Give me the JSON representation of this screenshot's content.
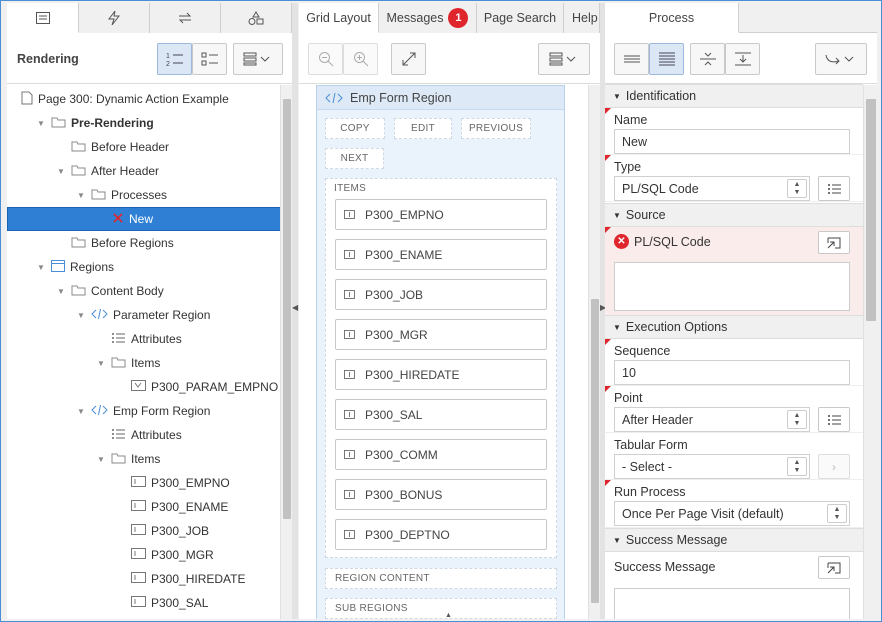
{
  "left_panel": {
    "tabs": [
      {
        "icon": "tree-list-icon",
        "active": true
      },
      {
        "icon": "lightning-icon",
        "active": false
      },
      {
        "icon": "arrows-exchange-icon",
        "active": false
      },
      {
        "icon": "shapes-icon",
        "active": false
      }
    ],
    "toolbar_title": "Rendering",
    "tree": [
      {
        "label": "Page 300: Dynamic Action Example",
        "icon": "page-icon",
        "level": 0,
        "toggle": ""
      },
      {
        "label": "Pre-Rendering",
        "icon": "folder-icon",
        "level": 1,
        "toggle": "open",
        "bold": true
      },
      {
        "label": "Before Header",
        "icon": "folder-icon",
        "level": 2,
        "toggle": ""
      },
      {
        "label": "After Header",
        "icon": "folder-icon",
        "level": 2,
        "toggle": "open"
      },
      {
        "label": "Processes",
        "icon": "folder-icon",
        "level": 3,
        "toggle": "open"
      },
      {
        "label": "New",
        "icon": "error-x-icon",
        "level": 4,
        "toggle": "",
        "selected": true
      },
      {
        "label": "Before Regions",
        "icon": "folder-icon",
        "level": 2,
        "toggle": ""
      },
      {
        "label": "Regions",
        "icon": "region-icon",
        "level": 1,
        "toggle": "open"
      },
      {
        "label": "Content Body",
        "icon": "folder-icon",
        "level": 2,
        "toggle": "open"
      },
      {
        "label": "Parameter Region",
        "icon": "code-icon",
        "level": 3,
        "toggle": "open"
      },
      {
        "label": "Attributes",
        "icon": "attributes-icon",
        "level": 4,
        "toggle": ""
      },
      {
        "label": "Items",
        "icon": "folder-icon",
        "level": 4,
        "toggle": "open"
      },
      {
        "label": "P300_PARAM_EMPNO",
        "icon": "select-item-icon",
        "level": 5,
        "toggle": ""
      },
      {
        "label": "Emp Form Region",
        "icon": "code-icon",
        "level": 3,
        "toggle": "open"
      },
      {
        "label": "Attributes",
        "icon": "attributes-icon",
        "level": 4,
        "toggle": ""
      },
      {
        "label": "Items",
        "icon": "folder-icon",
        "level": 4,
        "toggle": "open"
      },
      {
        "label": "P300_EMPNO",
        "icon": "text-item-icon",
        "level": 5,
        "toggle": ""
      },
      {
        "label": "P300_ENAME",
        "icon": "text-item-icon",
        "level": 5,
        "toggle": ""
      },
      {
        "label": "P300_JOB",
        "icon": "text-item-icon",
        "level": 5,
        "toggle": ""
      },
      {
        "label": "P300_MGR",
        "icon": "text-item-icon",
        "level": 5,
        "toggle": ""
      },
      {
        "label": "P300_HIREDATE",
        "icon": "text-item-icon",
        "level": 5,
        "toggle": ""
      },
      {
        "label": "P300_SAL",
        "icon": "text-item-icon",
        "level": 5,
        "toggle": ""
      }
    ]
  },
  "middle_panel": {
    "tabs": [
      {
        "label": "Grid Layout",
        "active": true
      },
      {
        "label": "Messages",
        "badge": "1"
      },
      {
        "label": "Page Search"
      },
      {
        "label": "Help"
      }
    ],
    "region_title": "Emp Form Region",
    "positions": [
      "COPY",
      "EDIT",
      "PREVIOUS",
      "NEXT"
    ],
    "items_label": "ITEMS",
    "items": [
      "P300_EMPNO",
      "P300_ENAME",
      "P300_JOB",
      "P300_MGR",
      "P300_HIREDATE",
      "P300_SAL",
      "P300_COMM",
      "P300_BONUS",
      "P300_DEPTNO"
    ],
    "region_content_label": "REGION CONTENT",
    "sub_regions_label": "SUB REGIONS"
  },
  "right_panel": {
    "tab_label": "Process",
    "sections": {
      "identification": "Identification",
      "source": "Source",
      "execution": "Execution Options",
      "success": "Success Message"
    },
    "fields": {
      "name_label": "Name",
      "name_value": "New",
      "type_label": "Type",
      "type_value": "PL/SQL Code",
      "plsql_label": "PL/SQL Code",
      "sequence_label": "Sequence",
      "sequence_value": "10",
      "point_label": "Point",
      "point_value": "After Header",
      "tabular_label": "Tabular Form",
      "tabular_value": "- Select -",
      "run_label": "Run Process",
      "run_value": "Once Per Page Visit (default)",
      "success_label": "Success Message"
    }
  },
  "colors": {
    "accent": "#2f80d5",
    "error": "#e0262d",
    "region_bg": "#eaf2fb"
  }
}
